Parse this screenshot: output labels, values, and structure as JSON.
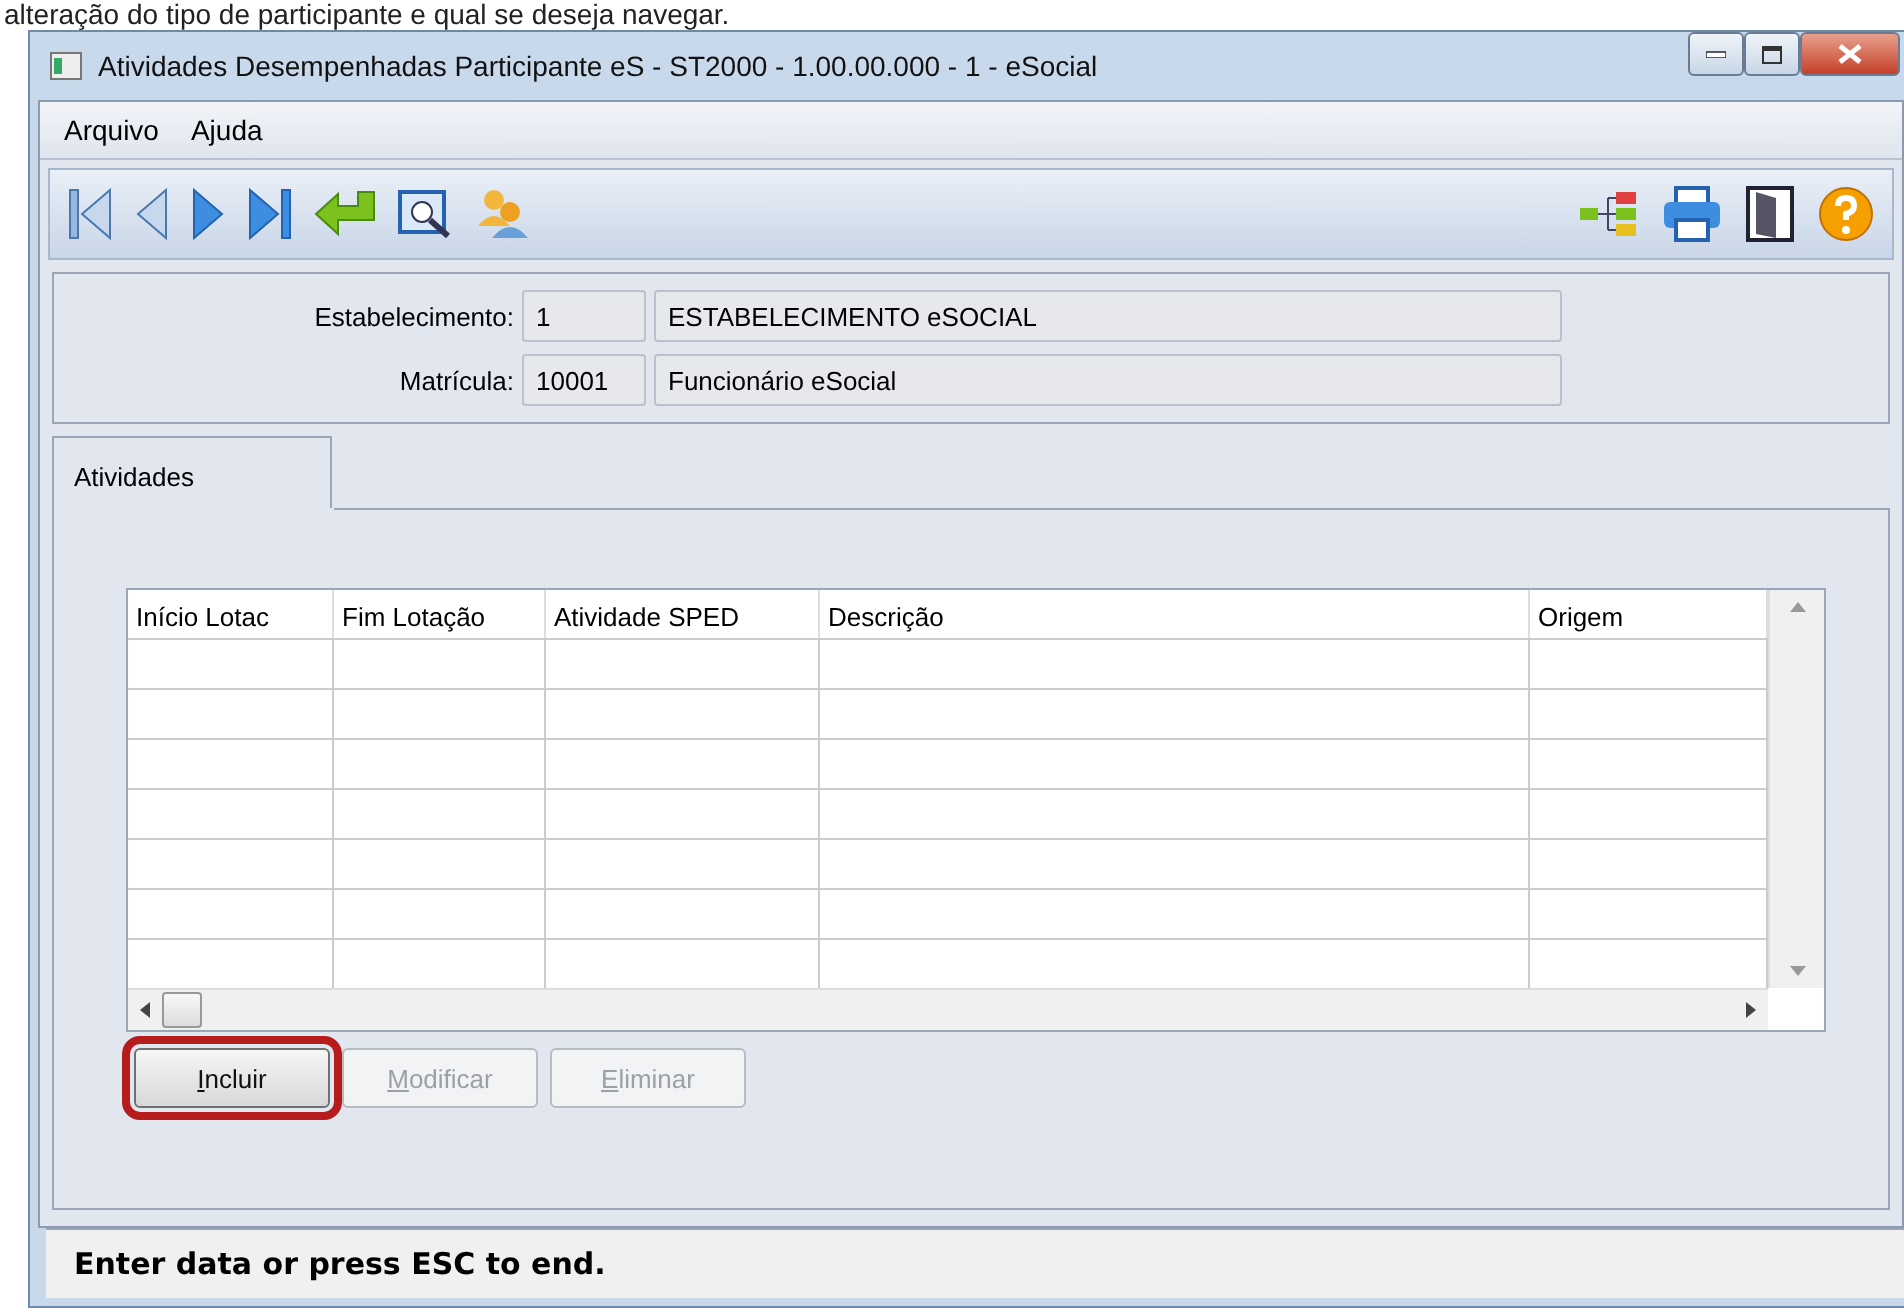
{
  "document_text": "alteração do tipo de participante e qual se deseja navegar.",
  "window": {
    "title": "Atividades Desempenhadas Participante eS - ST2000 - 1.00.00.000 - 1 - eSocial"
  },
  "menu": [
    "Arquivo",
    "Ajuda"
  ],
  "header": {
    "fields": [
      {
        "label": "Estabelecimento:",
        "code": "1",
        "description": "ESTABELECIMENTO eSOCIAL"
      },
      {
        "label": "Matrícula:",
        "code": "10001",
        "description": "Funcionário eSocial"
      }
    ]
  },
  "tabs": [
    {
      "label": "Atividades",
      "selected": true
    }
  ],
  "table": {
    "columns": [
      "Início Lotac",
      "Fim Lotação",
      "Atividade SPED",
      "Descrição",
      "Origem"
    ]
  },
  "buttons": [
    {
      "label": "Incluir",
      "disabled": false,
      "highlighted": true
    },
    {
      "label": "Modificar",
      "disabled": true,
      "highlighted": false
    },
    {
      "label": "Eliminar",
      "disabled": true,
      "highlighted": false
    }
  ],
  "status_bar": "Enter data or press ESC to end."
}
